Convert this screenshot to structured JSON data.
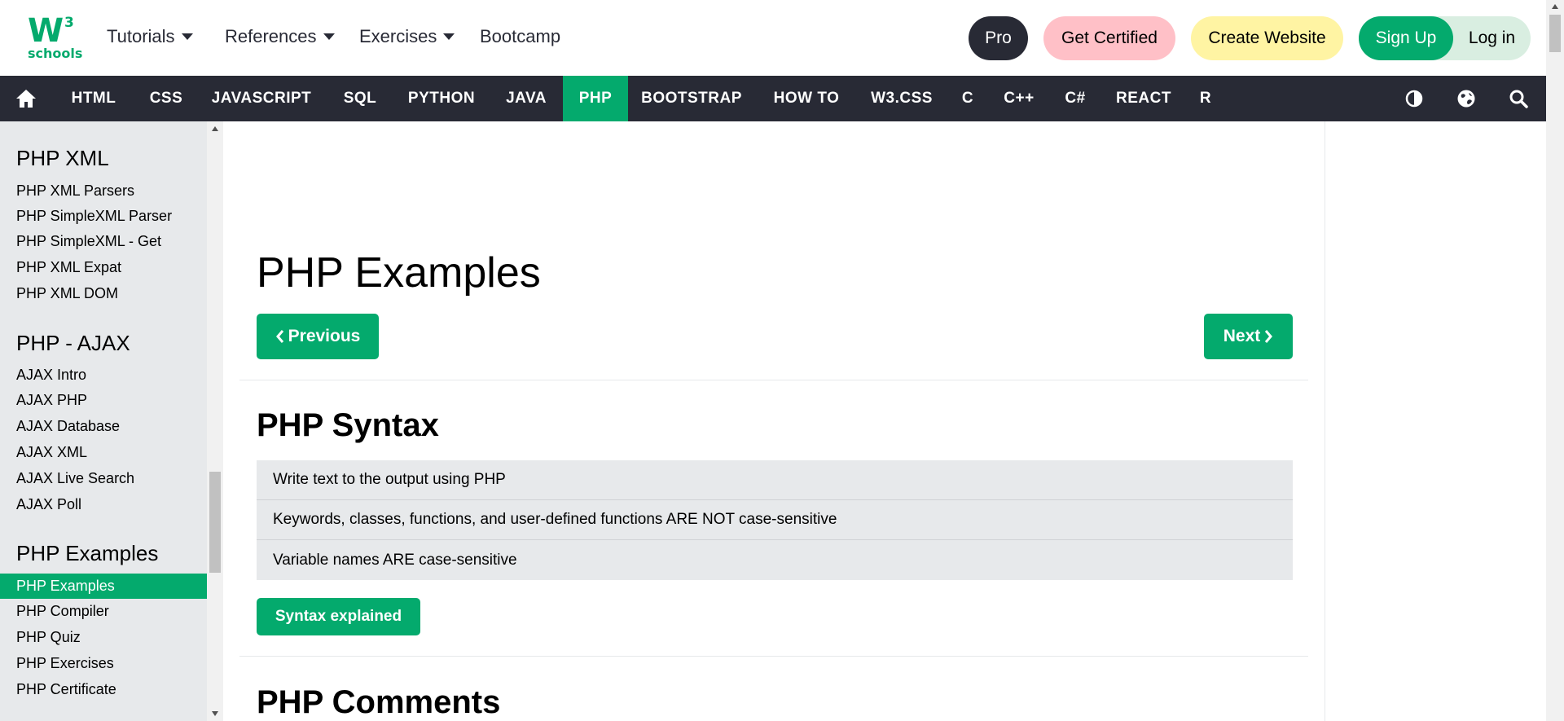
{
  "brand": {
    "logo_w": "W",
    "logo_sup": "3",
    "logo_sub": "schools"
  },
  "topnav": {
    "tutorials": "Tutorials",
    "references": "References",
    "exercises": "Exercises",
    "bootcamp": "Bootcamp",
    "pro": "Pro",
    "get_certified": "Get Certified",
    "create_website": "Create Website",
    "sign_up": "Sign Up",
    "log_in": "Log in"
  },
  "langnav": {
    "items": [
      "HTML",
      "CSS",
      "JAVASCRIPT",
      "SQL",
      "PYTHON",
      "JAVA",
      "PHP",
      "BOOTSTRAP",
      "HOW TO",
      "W3.CSS",
      "C",
      "C++",
      "C#",
      "REACT",
      "R"
    ],
    "active": "PHP"
  },
  "sidebar": {
    "sections": [
      {
        "heading": "PHP XML",
        "links": [
          "PHP XML Parsers",
          "PHP SimpleXML Parser",
          "PHP SimpleXML - Get",
          "PHP XML Expat",
          "PHP XML DOM"
        ]
      },
      {
        "heading": "PHP - AJAX",
        "links": [
          "AJAX Intro",
          "AJAX PHP",
          "AJAX Database",
          "AJAX XML",
          "AJAX Live Search",
          "AJAX Poll"
        ]
      },
      {
        "heading": "PHP Examples",
        "links": [
          "PHP Examples",
          "PHP Compiler",
          "PHP Quiz",
          "PHP Exercises",
          "PHP Certificate"
        ]
      }
    ],
    "active_link": "PHP Examples"
  },
  "main": {
    "title": "PHP Examples",
    "prev_label": "Previous",
    "next_label": "Next",
    "sections": [
      {
        "title": "PHP Syntax",
        "examples": [
          "Write text to the output using PHP",
          "Keywords, classes, functions, and user-defined functions ARE NOT case-sensitive",
          "Variable names ARE case-sensitive"
        ],
        "button": "Syntax explained"
      },
      {
        "title": "PHP Comments"
      }
    ]
  },
  "colors": {
    "accent": "#04AA6D",
    "dark": "#282A35",
    "sidebar_bg": "#E7E9EB",
    "cert_pink": "#FFC0C7",
    "create_yellow": "#FFF4A3"
  },
  "icons": [
    "home-icon",
    "contrast-icon",
    "globe-icon",
    "search-icon",
    "chevron-left-icon",
    "chevron-right-icon"
  ]
}
